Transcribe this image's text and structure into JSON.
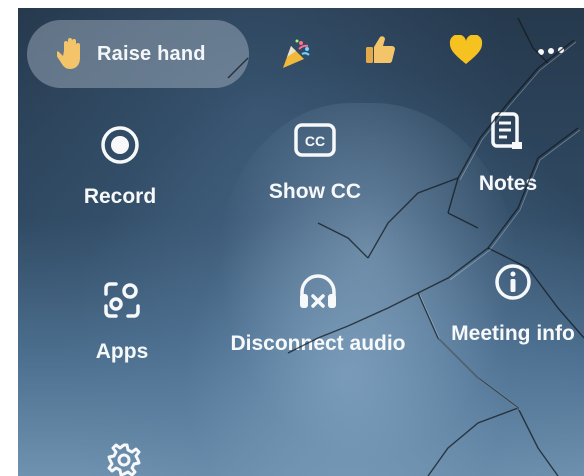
{
  "reactions": {
    "raise_hand_label": "Raise hand",
    "items": [
      {
        "name": "celebrate",
        "icon": "party-popper-icon"
      },
      {
        "name": "like",
        "icon": "thumbs-up-icon"
      },
      {
        "name": "love",
        "icon": "heart-icon"
      },
      {
        "name": "more",
        "icon": "more-icon"
      }
    ]
  },
  "menu": {
    "record_label": "Record",
    "show_cc_label": "Show CC",
    "notes_label": "Notes",
    "apps_label": "Apps",
    "disconnect_audio_label": "Disconnect audio",
    "meeting_info_label": "Meeting info"
  },
  "colors": {
    "heart": "#f6c21f",
    "thumb": "#f3c46a",
    "icon_white": "#f6f8fa",
    "raise_hand_bg": "#9aa9b8"
  }
}
